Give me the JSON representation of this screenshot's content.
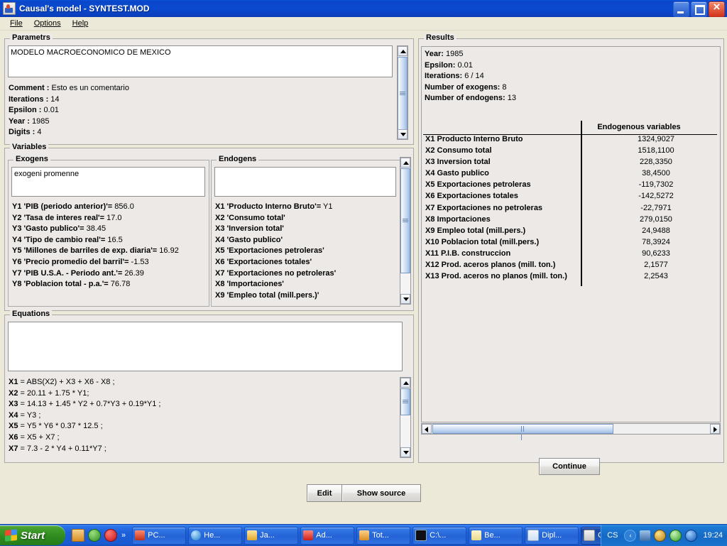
{
  "window": {
    "title": "Causal's model - SYNTEST.MOD",
    "icon": "java-coffee-cup-icon",
    "buttons": {
      "minimize": "minimize",
      "maximize": "maximize",
      "close": "close"
    }
  },
  "menu": {
    "items": [
      "File",
      "Options",
      "Help"
    ]
  },
  "parametrs": {
    "legend": "Parametrs",
    "editor_value": "MODELO MACROECONOMICO DE MEXICO",
    "lines": [
      {
        "label": "Comment :",
        "value": "Esto es un comentario"
      },
      {
        "label": "Iterations :",
        "value": "14"
      },
      {
        "label": "Epsilon :",
        "value": "0.01"
      },
      {
        "label": "Year :",
        "value": "1985"
      },
      {
        "label": "Digits :",
        "value": "4"
      }
    ]
  },
  "variables": {
    "legend": "Variables",
    "exogens": {
      "legend": "Exogens",
      "editor_value": "exogeni promenne",
      "items": [
        {
          "name": "Y1 'PIB (periodo anterior)'=",
          "value": "856.0"
        },
        {
          "name": "Y2 'Tasa de interes real'=",
          "value": "17.0"
        },
        {
          "name": "Y3 'Gasto publico'=",
          "value": "38.45"
        },
        {
          "name": "Y4 'Tipo de cambio real'=",
          "value": "16.5"
        },
        {
          "name": "Y5 'Millones de barriles de exp. diaria'=",
          "value": "16.92"
        },
        {
          "name": "Y6 'Precio promedio del barril'=",
          "value": "-1.53"
        },
        {
          "name": "Y7 'PIB U.S.A. - Periodo ant.'=",
          "value": "26.39"
        },
        {
          "name": "Y8 'Poblacion total - p.a.'=",
          "value": "76.78"
        }
      ]
    },
    "endogens": {
      "legend": "Endogens",
      "editor_value": "",
      "items": [
        {
          "name": "X1 'Producto Interno Bruto'=",
          "value": "Y1"
        },
        {
          "name": "X2 'Consumo total'",
          "value": ""
        },
        {
          "name": "X3 'Inversion total'",
          "value": ""
        },
        {
          "name": "X4 'Gasto publico'",
          "value": ""
        },
        {
          "name": "X5 'Exportaciones petroleras'",
          "value": ""
        },
        {
          "name": "X6 'Exportaciones totales'",
          "value": ""
        },
        {
          "name": "X7 'Exportaciones no petroleras'",
          "value": ""
        },
        {
          "name": "X8 'Importaciones'",
          "value": ""
        },
        {
          "name": "X9 'Empleo total (mill.pers.)'",
          "value": ""
        }
      ]
    }
  },
  "equations": {
    "legend": "Equations",
    "editor_value": "",
    "items": [
      {
        "name": "X1",
        "value": "= ABS(X2) + X3 + X6 - X8 ;"
      },
      {
        "name": "X2",
        "value": "= 20.11 + 1.75 * Y1;"
      },
      {
        "name": "X3",
        "value": "= 14.13 + 1.45 * Y2 + 0.7*Y3 + 0.19*Y1 ;"
      },
      {
        "name": "X4",
        "value": "= Y3 ;"
      },
      {
        "name": "X5",
        "value": "= Y5 * Y6 * 0.37 * 12.5 ;"
      },
      {
        "name": "X6",
        "value": "= X5 + X7 ;"
      },
      {
        "name": "X7",
        "value": "= 7.3 - 2 * Y4 + 0.11*Y7 ;"
      }
    ]
  },
  "results": {
    "legend": "Results",
    "summary": [
      {
        "label": "Year:",
        "value": "1985"
      },
      {
        "label": "Epsilon:",
        "value": "0.01"
      },
      {
        "label": "Iterations:",
        "value": "6 / 14"
      },
      {
        "label": "Number of exogens:",
        "value": "8"
      },
      {
        "label": "Number of endogens:",
        "value": "13"
      }
    ],
    "table_header": "Endogenous variables",
    "rows": [
      {
        "name": "X1 Producto Interno Bruto",
        "value": "1324,9027"
      },
      {
        "name": "X2 Consumo total",
        "value": "1518,1100"
      },
      {
        "name": "X3 Inversion total",
        "value": "228,3350"
      },
      {
        "name": "X4 Gasto publico",
        "value": "38,4500"
      },
      {
        "name": "X5 Exportaciones petroleras",
        "value": "-119,7302"
      },
      {
        "name": "X6 Exportaciones totales",
        "value": "-142,5272"
      },
      {
        "name": "X7 Exportaciones no petroleras",
        "value": "-22,7971"
      },
      {
        "name": "X8 Importaciones",
        "value": "279,0150"
      },
      {
        "name": "X9 Empleo total (mill.pers.)",
        "value": "24,9488"
      },
      {
        "name": "X10 Poblacion total (mill.pers.)",
        "value": "78,3924"
      },
      {
        "name": "X11 P.I.B. construccion",
        "value": "90,6233"
      },
      {
        "name": "X12 Prod. aceros planos (mill. ton.)",
        "value": "2,1577"
      },
      {
        "name": "X13 Prod. aceros no planos (mill. ton.)",
        "value": "2,2543"
      }
    ],
    "continue_label": "Continue"
  },
  "footer": {
    "edit_label": "Edit",
    "show_source_label": "Show source"
  },
  "taskbar": {
    "start_label": "Start",
    "quicklaunch": [
      {
        "name": "show-desktop-icon",
        "color": "#e8a33d"
      },
      {
        "name": "media-player-icon",
        "color": "#4fae3e"
      },
      {
        "name": "opera-icon",
        "color": "#e0202a"
      }
    ],
    "overflow_glyph": "»",
    "tasks": [
      {
        "label": "PC...",
        "icon_color": "#d94b3a",
        "active": false
      },
      {
        "label": "He...",
        "icon_color": "#3da7e8",
        "active": false
      },
      {
        "label": "Ja...",
        "icon_color": "#f0c64a",
        "active": false
      },
      {
        "label": "Ad...",
        "icon_color": "#e23a2e",
        "active": false
      },
      {
        "label": "Tot...",
        "icon_color": "#e8a33d",
        "active": false
      },
      {
        "label": "C:\\...",
        "icon_color": "#16161a",
        "active": false
      },
      {
        "label": "Be...",
        "icon_color": "#f2e7b0",
        "active": false
      },
      {
        "label": "Dipl...",
        "icon_color": "#3a6fd0",
        "active": false
      },
      {
        "label": "Ca...",
        "icon_color": "#cfcfcf",
        "active": true
      }
    ],
    "tray": {
      "cs_label": "CS",
      "chevron_glyph": "‹",
      "icons": [
        {
          "name": "network-icon",
          "color": "#6fa0d8"
        },
        {
          "name": "globe-icon",
          "color": "#d9a21c"
        },
        {
          "name": "antivirus-icon",
          "color": "#57c24e"
        },
        {
          "name": "bluetooth-icon",
          "color": "#1d74d8"
        }
      ],
      "clock": "19:24"
    }
  }
}
